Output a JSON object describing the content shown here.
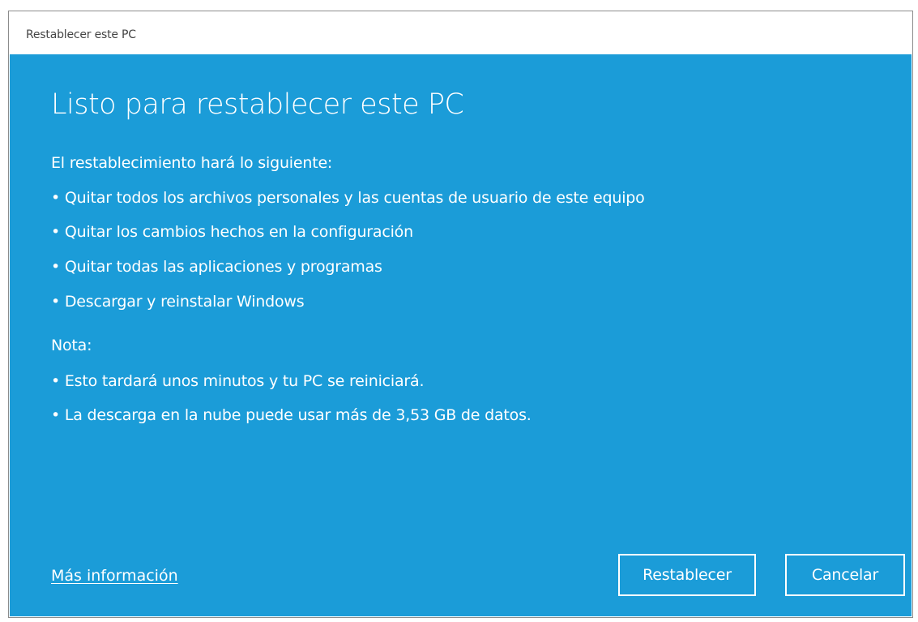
{
  "window": {
    "title": "Restablecer este PC"
  },
  "main": {
    "heading": "Listo para restablecer este PC",
    "intro": "El restablecimiento hará lo siguiente:",
    "actions": [
      "•  Quitar todos los archivos personales y las cuentas de usuario de este equipo",
      "•  Quitar los cambios hechos en la configuración",
      "•  Quitar todas las aplicaciones y programas",
      "• Descargar y reinstalar Windows"
    ],
    "note_label": "Nota:",
    "notes": [
      "• Esto tardará unos minutos y tu PC se reiniciará.",
      "• La descarga en la nube puede usar más de 3,53 GB de datos."
    ]
  },
  "footer": {
    "more_info_link": "Más información",
    "reset_button": "Restablecer",
    "cancel_button": "Cancelar"
  },
  "colors": {
    "background": "#1b9cd8",
    "text": "#ffffff"
  }
}
